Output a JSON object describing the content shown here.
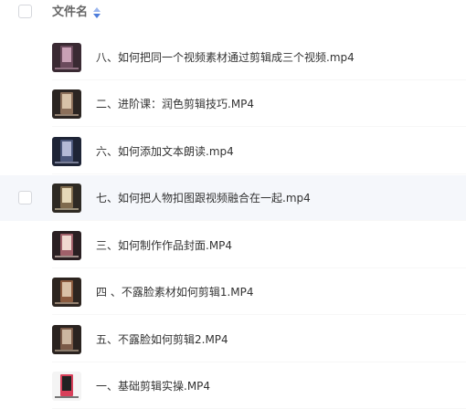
{
  "header": {
    "column_label": "文件名",
    "sort_icon": "sort-icon"
  },
  "files": [
    {
      "name": "八、如何把同一个视频素材通过剪辑成三个视频.mp4",
      "thumb_colors": [
        "#3a2a33",
        "#c9a0b5",
        "#6b4a5c"
      ]
    },
    {
      "name": "二、进阶课：润色剪辑技巧.MP4",
      "thumb_colors": [
        "#2b2522",
        "#d8c2a8",
        "#8b6f5a"
      ]
    },
    {
      "name": "六、如何添加文本朗读.mp4",
      "thumb_colors": [
        "#1e2436",
        "#b4b9d6",
        "#4b567a"
      ]
    },
    {
      "name": "七、如何把人物扣图跟视频融合在一起.mp4",
      "thumb_colors": [
        "#2e2a24",
        "#e6d9b8",
        "#7f6b4e"
      ]
    },
    {
      "name": "三、如何制作作品封面.MP4",
      "thumb_colors": [
        "#2a1f22",
        "#f0d8d0",
        "#a0606a"
      ]
    },
    {
      "name": "四 、不露脸素材如何剪辑1.MP4",
      "thumb_colors": [
        "#2d2520",
        "#d9c0a6",
        "#8a5a3e"
      ]
    },
    {
      "name": "五、不露脸如何剪辑2.MP4",
      "thumb_colors": [
        "#2a2320",
        "#ccb6a0",
        "#7a5a48"
      ]
    },
    {
      "name": "一、基础剪辑实操.MP4",
      "thumb_colors": [
        "#f4f4f4",
        "#222222",
        "#d8405a"
      ]
    }
  ],
  "hover_row_index": 3
}
